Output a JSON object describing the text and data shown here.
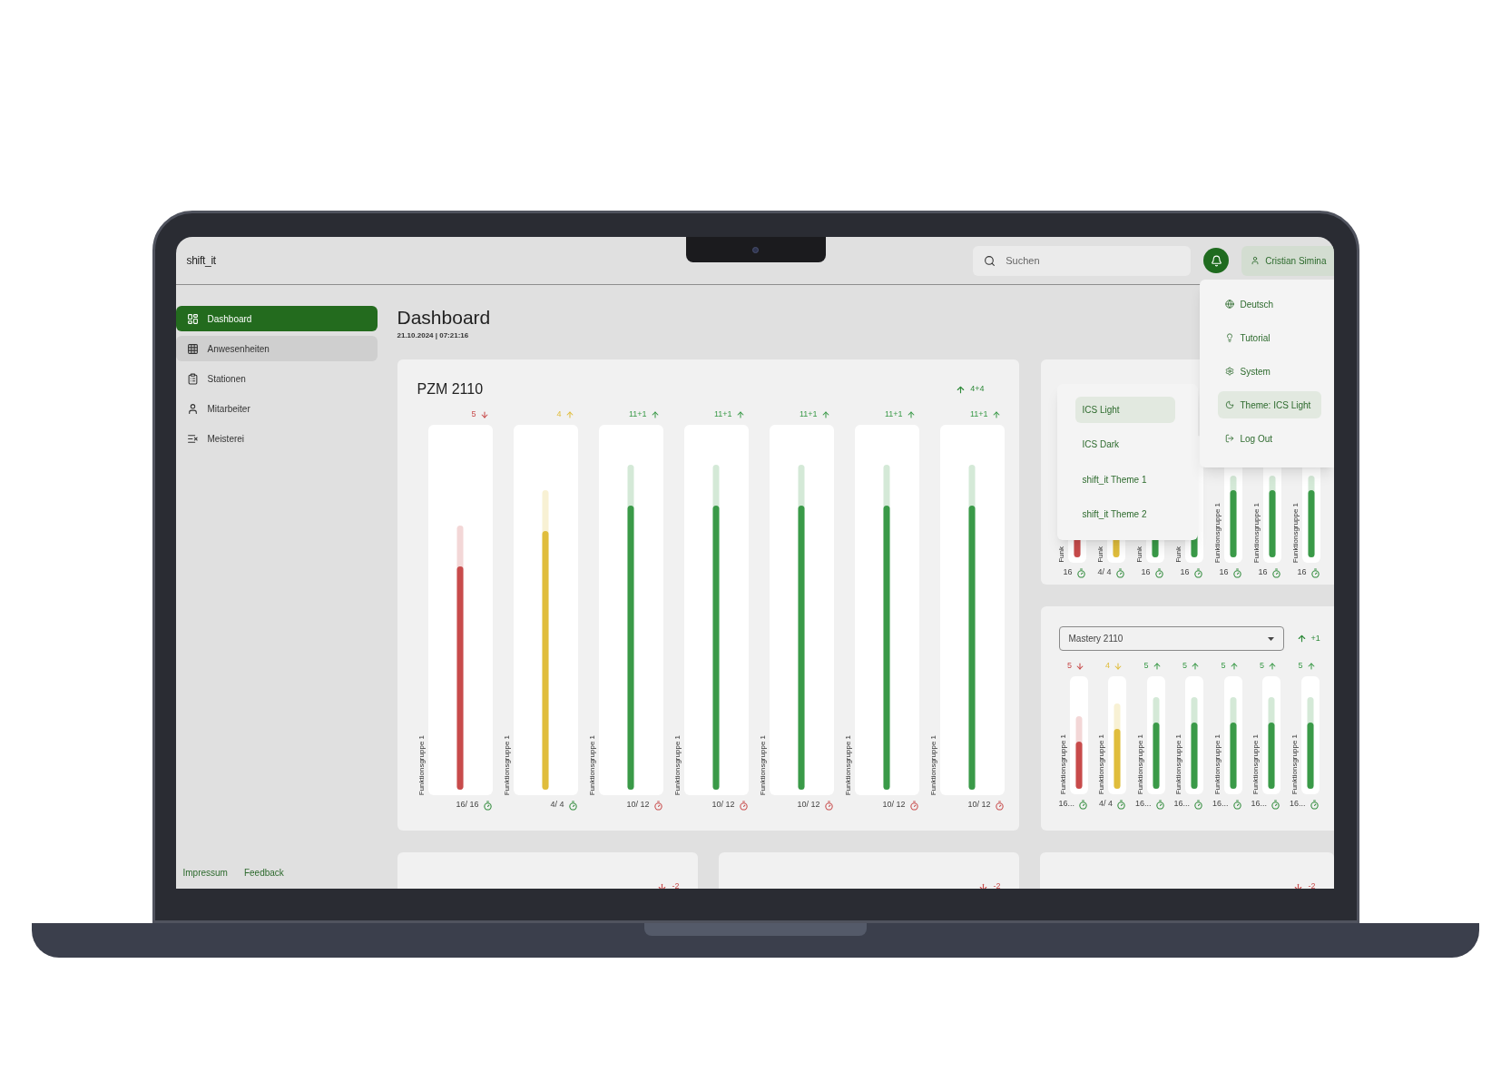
{
  "topbar": {
    "logo": "shift_it",
    "search": {
      "placeholder": "Suchen"
    },
    "user": "Cristian Simina"
  },
  "sidebar": {
    "items": [
      {
        "label": "Dashboard",
        "selected": true,
        "hovered": false
      },
      {
        "label": "Anwesenheiten",
        "selected": false,
        "hovered": true
      },
      {
        "label": "Stationen",
        "selected": false,
        "hovered": false
      },
      {
        "label": "Mitarbeiter",
        "selected": false,
        "hovered": false
      },
      {
        "label": "Meisterei",
        "selected": false,
        "hovered": false
      }
    ],
    "footer_links": [
      "Impressum",
      "Feedback"
    ]
  },
  "page": {
    "title": "Dashboard",
    "timestamp": "21.10.2024 | 07:21:16"
  },
  "pzm_card": {
    "title": "PZM 2110",
    "trend": {
      "rising": true,
      "value": "4+4"
    },
    "columns": [
      {
        "label": "Funktionsgruppe 1",
        "count": "5",
        "rising": false,
        "color": "#c84b4b",
        "level": 0.62,
        "reading": "16/ 16",
        "on_time": true
      },
      {
        "label": "Funktionsgruppe 1",
        "count": "4",
        "rising": true,
        "color": "#e0bd3c",
        "level": 0.72,
        "reading": "4/ 4",
        "on_time": true
      },
      {
        "label": "Funktionsgruppe 1",
        "count": "11+1",
        "rising": true,
        "color": "#3a9a48",
        "level": 0.79,
        "reading": "10/ 12",
        "on_time": false
      },
      {
        "label": "Funktionsgruppe 1",
        "count": "11+1",
        "rising": true,
        "color": "#3a9a48",
        "level": 0.79,
        "reading": "10/ 12",
        "on_time": false
      },
      {
        "label": "Funktionsgruppe 1",
        "count": "11+1",
        "rising": true,
        "color": "#3a9a48",
        "level": 0.79,
        "reading": "10/ 12",
        "on_time": false
      },
      {
        "label": "Funktionsgruppe 1",
        "count": "11+1",
        "rising": true,
        "color": "#3a9a48",
        "level": 0.79,
        "reading": "10/ 12",
        "on_time": false
      },
      {
        "label": "Funktionsgruppe 1",
        "count": "11+1",
        "rising": true,
        "color": "#3a9a48",
        "level": 0.79,
        "reading": "10/ 12",
        "on_time": false
      }
    ]
  },
  "second_card": {
    "columns": [
      {
        "label": "Funk",
        "color": "#c84b4b",
        "level": 0.4,
        "reading": "16",
        "on_time": true
      },
      {
        "label": "Funk",
        "color": "#e0bd3c",
        "level": 0.45,
        "reading": "4/ 4",
        "on_time": true
      },
      {
        "label": "Funk",
        "color": "#3a9a48",
        "level": 0.58,
        "reading": "16",
        "on_time": true
      },
      {
        "label": "Funk",
        "color": "#3a9a48",
        "level": 0.58,
        "reading": "16",
        "on_time": true
      },
      {
        "label": "Funktionsgruppe 1",
        "color": "#3a9a48",
        "level": 0.58,
        "reading": "16",
        "on_time": true
      },
      {
        "label": "Funktionsgruppe 1",
        "color": "#3a9a48",
        "level": 0.58,
        "reading": "16",
        "on_time": true
      },
      {
        "label": "Funktionsgruppe 1",
        "color": "#3a9a48",
        "level": 0.58,
        "reading": "16",
        "on_time": true
      }
    ]
  },
  "mastery_card": {
    "select": {
      "value": "Mastery 2110"
    },
    "trend": {
      "rising": true,
      "value": "+1"
    },
    "columns": [
      {
        "label": "Funktionsgruppe 1",
        "count": "5",
        "rising": false,
        "color": "#c84b4b",
        "level": 0.44,
        "reading": "16...",
        "on_time": true
      },
      {
        "label": "Funktionsgruppe 1",
        "count": "4",
        "rising": false,
        "color": "#e0bd3c",
        "level": 0.56,
        "reading": "4/ 4",
        "on_time": true
      },
      {
        "label": "Funktionsgruppe 1",
        "count": "5",
        "rising": true,
        "color": "#3a9a48",
        "level": 0.62,
        "reading": "16...",
        "on_time": true
      },
      {
        "label": "Funktionsgruppe 1",
        "count": "5",
        "rising": true,
        "color": "#3a9a48",
        "level": 0.62,
        "reading": "16...",
        "on_time": true
      },
      {
        "label": "Funktionsgruppe 1",
        "count": "5",
        "rising": true,
        "color": "#3a9a48",
        "level": 0.62,
        "reading": "16...",
        "on_time": true
      },
      {
        "label": "Funktionsgruppe 1",
        "count": "5",
        "rising": true,
        "color": "#3a9a48",
        "level": 0.62,
        "reading": "16...",
        "on_time": true
      },
      {
        "label": "Funktionsgruppe 1",
        "count": "5",
        "rising": true,
        "color": "#3a9a48",
        "level": 0.62,
        "reading": "16...",
        "on_time": true
      }
    ]
  },
  "bottom_cards": [
    {
      "trend": {
        "rising": false,
        "value": "-2"
      }
    },
    {
      "trend": {
        "rising": false,
        "value": "-2"
      }
    },
    {
      "trend": {
        "rising": false,
        "value": "-2"
      }
    }
  ],
  "user_menu": {
    "items": [
      {
        "label": "Deutsch",
        "selected": false
      },
      {
        "label": "Tutorial",
        "selected": false
      },
      {
        "label": "System",
        "selected": false
      },
      {
        "label": "Theme: ICS Light",
        "selected": true
      },
      {
        "label": "Log Out",
        "selected": false
      }
    ]
  },
  "theme_menu": {
    "items": [
      {
        "label": "ICS Light",
        "selected": true
      },
      {
        "label": "ICS Dark",
        "selected": false
      },
      {
        "label": "shift_it Theme 1",
        "selected": false
      },
      {
        "label": "shift_it Theme 2",
        "selected": false
      }
    ]
  }
}
